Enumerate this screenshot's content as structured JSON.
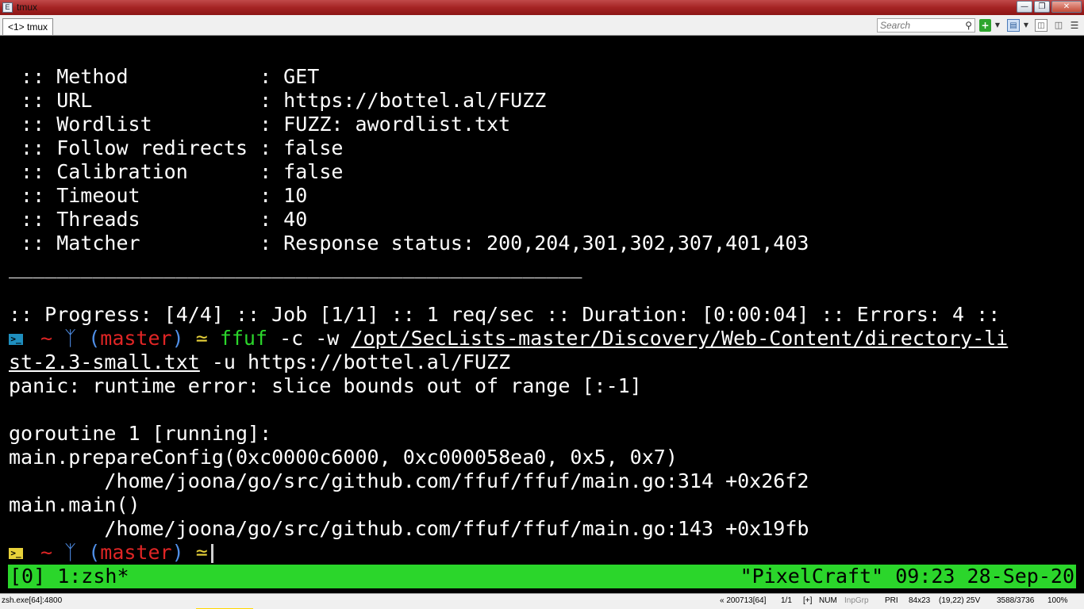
{
  "window": {
    "title": "tmux",
    "app_icon": "console-icon",
    "controls": [
      "minimize",
      "maximize",
      "close"
    ]
  },
  "tabbar": {
    "tab_label": "<1> tmux",
    "search_placeholder": "Search",
    "tools": [
      "add-console-icon",
      "dropdown-icon",
      "pane-icon",
      "dropdown-icon",
      "layout-icon",
      "split-icon",
      "menu-icon"
    ]
  },
  "terminal": {
    "config": [
      {
        "key": "Method",
        "value": "GET"
      },
      {
        "key": "URL",
        "value": "https://bottel.al/FUZZ"
      },
      {
        "key": "Wordlist",
        "value": "FUZZ: awordlist.txt"
      },
      {
        "key": "Follow redirects",
        "value": "false"
      },
      {
        "key": "Calibration",
        "value": "false"
      },
      {
        "key": "Timeout",
        "value": "10"
      },
      {
        "key": "Threads",
        "value": "40"
      },
      {
        "key": "Matcher",
        "value": "Response status: 200,204,301,302,307,401,403"
      }
    ],
    "config_lines": [
      " :: Method           : GET",
      " :: URL              : https://bottel.al/FUZZ",
      " :: Wordlist         : FUZZ: awordlist.txt",
      " :: Follow redirects : false",
      " :: Calibration      : false",
      " :: Timeout          : 10",
      " :: Threads          : 40",
      " :: Matcher          : Response status: 200,204,301,302,307,401,403"
    ],
    "separator": "________________________________________________",
    "progress": ":: Progress: [4/4] :: Job [1/1] :: 1 req/sec :: Duration: [0:00:04] :: Errors: 4 ::",
    "prompt": {
      "dir": "~",
      "branch_open": "(",
      "branch": "master",
      "branch_close": ")",
      "symbol": "≃"
    },
    "command": {
      "name": "ffuf",
      "args1": " -c -w ",
      "path_part1": "/opt/SecLists-master/Discovery/Web-Content/directory-li",
      "path_part2": "st-2.3-small.txt",
      "args2": " -u https://bottel.al/FUZZ"
    },
    "output": [
      "panic: runtime error: slice bounds out of range [:-1]",
      "",
      "goroutine 1 [running]:",
      "main.prepareConfig(0xc0000c6000, 0xc000058ea0, 0x5, 0x7)",
      "        /home/joona/go/src/github.com/ffuf/ffuf/main.go:314 +0x26f2",
      "main.main()",
      "        /home/joona/go/src/github.com/ffuf/ffuf/main.go:143 +0x19fb"
    ]
  },
  "tmux_status": {
    "left": "[0] 1:zsh*",
    "right": "\"PixelCraft\" 09:23 28-Sep-20"
  },
  "statusbar": {
    "process": "zsh.exe[64]:4800",
    "pid_info": "« 200713[64]",
    "tab_pos": "1/1",
    "ins": "[+]",
    "num": "NUM",
    "inp": "InpGrp",
    "pri": "PRI",
    "size": "84x23",
    "cursor": "(19,22) 25V",
    "buffer": "3588/3736",
    "zoom": "100%"
  }
}
